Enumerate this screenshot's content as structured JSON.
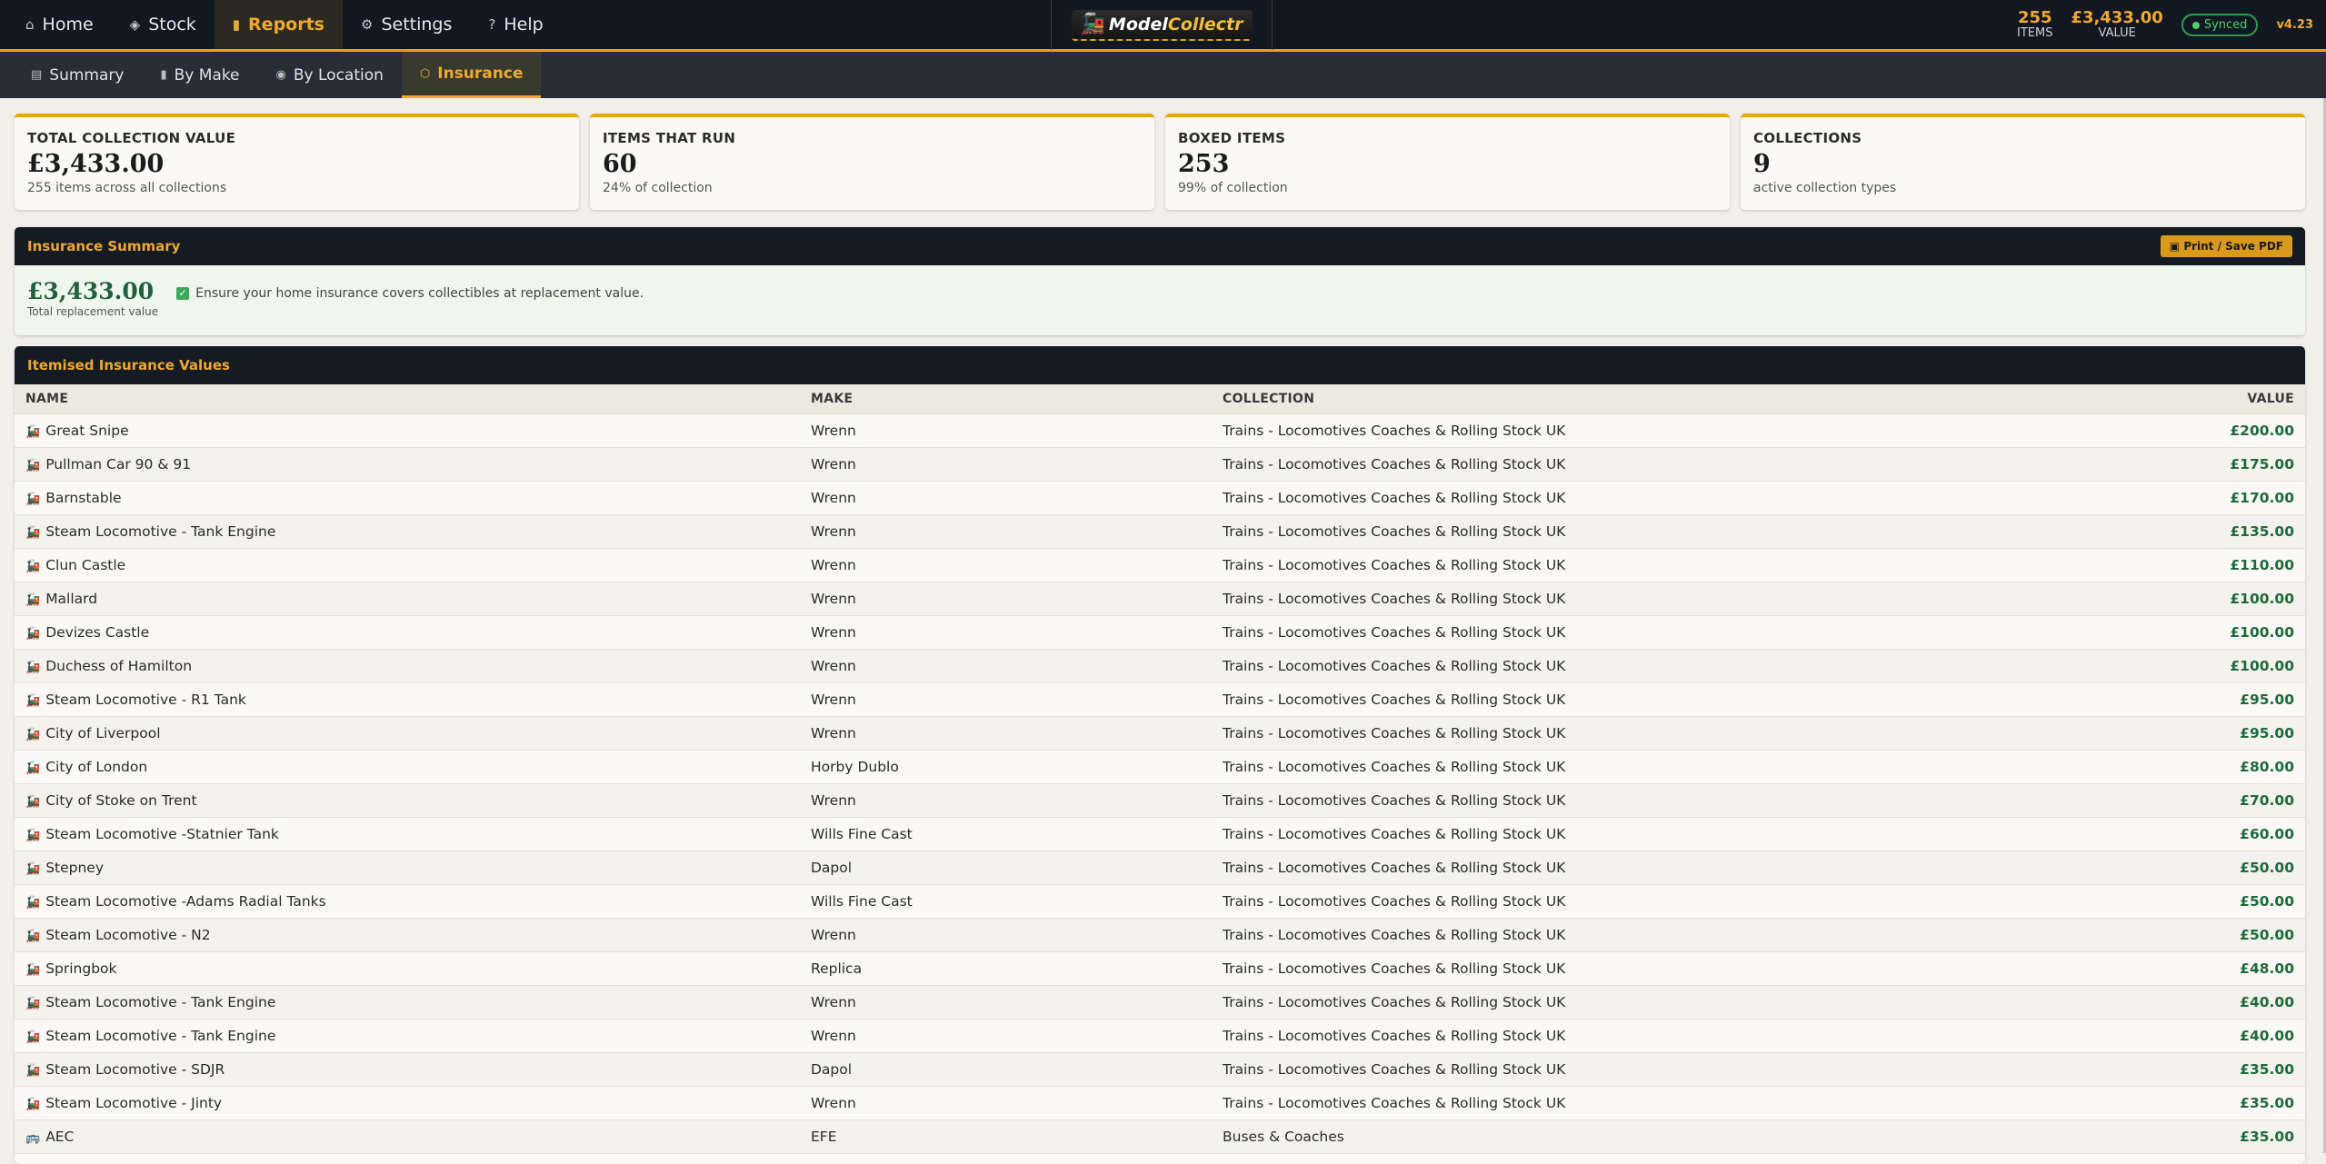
{
  "nav": {
    "items": [
      {
        "label": "Home",
        "icon": "home-icon"
      },
      {
        "label": "Stock",
        "icon": "box-icon"
      },
      {
        "label": "Reports",
        "icon": "bar-chart-icon",
        "active": true
      },
      {
        "label": "Settings",
        "icon": "gear-icon"
      },
      {
        "label": "Help",
        "icon": "question-icon"
      }
    ]
  },
  "logo": {
    "part1": "Model",
    "part2": "Collectr"
  },
  "header_stats": {
    "items_value": "255",
    "items_label": "ITEMS",
    "value_value": "£3,433.00",
    "value_label": "VALUE",
    "sync_label": "Synced",
    "version": "v4.23"
  },
  "subnav": {
    "items": [
      {
        "label": "Summary"
      },
      {
        "label": "By Make"
      },
      {
        "label": "By Location"
      },
      {
        "label": "Insurance",
        "active": true
      }
    ]
  },
  "cards": [
    {
      "label": "TOTAL COLLECTION VALUE",
      "value": "£3,433.00",
      "sub": "255 items across all collections"
    },
    {
      "label": "ITEMS THAT RUN",
      "value": "60",
      "sub": "24% of collection"
    },
    {
      "label": "BOXED ITEMS",
      "value": "253",
      "sub": "99% of collection"
    },
    {
      "label": "COLLECTIONS",
      "value": "9",
      "sub": "active collection types"
    }
  ],
  "insurance": {
    "title": "Insurance Summary",
    "print_label": "Print / Save PDF",
    "amount": "£3,433.00",
    "amount_label": "Total replacement value",
    "note": "Ensure your home insurance covers collectibles at replacement value."
  },
  "itemised": {
    "title": "Itemised Insurance Values",
    "headers": {
      "name": "NAME",
      "make": "MAKE",
      "collection": "COLLECTION",
      "value": "VALUE"
    },
    "rows": [
      {
        "name": "Great Snipe",
        "make": "Wrenn",
        "collection": "Trains - Locomotives Coaches & Rolling Stock UK",
        "value": "£200.00"
      },
      {
        "name": "Pullman Car 90 & 91",
        "make": "Wrenn",
        "collection": "Trains - Locomotives Coaches & Rolling Stock UK",
        "value": "£175.00"
      },
      {
        "name": "Barnstable",
        "make": "Wrenn",
        "collection": "Trains - Locomotives Coaches & Rolling Stock UK",
        "value": "£170.00"
      },
      {
        "name": "Steam Locomotive - Tank Engine",
        "make": "Wrenn",
        "collection": "Trains - Locomotives Coaches & Rolling Stock UK",
        "value": "£135.00"
      },
      {
        "name": "Clun Castle",
        "make": "Wrenn",
        "collection": "Trains - Locomotives Coaches & Rolling Stock UK",
        "value": "£110.00"
      },
      {
        "name": "Mallard",
        "make": "Wrenn",
        "collection": "Trains - Locomotives Coaches & Rolling Stock UK",
        "value": "£100.00"
      },
      {
        "name": "Devizes Castle",
        "make": "Wrenn",
        "collection": "Trains - Locomotives Coaches & Rolling Stock UK",
        "value": "£100.00"
      },
      {
        "name": "Duchess of Hamilton",
        "make": "Wrenn",
        "collection": "Trains - Locomotives Coaches & Rolling Stock UK",
        "value": "£100.00"
      },
      {
        "name": "Steam Locomotive - R1 Tank",
        "make": "Wrenn",
        "collection": "Trains - Locomotives Coaches & Rolling Stock UK",
        "value": "£95.00"
      },
      {
        "name": "City of Liverpool",
        "make": "Wrenn",
        "collection": "Trains - Locomotives Coaches & Rolling Stock UK",
        "value": "£95.00"
      },
      {
        "name": "City of London",
        "make": "Horby Dublo",
        "collection": "Trains - Locomotives Coaches & Rolling Stock UK",
        "value": "£80.00"
      },
      {
        "name": "City of Stoke on Trent",
        "make": "Wrenn",
        "collection": "Trains - Locomotives Coaches & Rolling Stock UK",
        "value": "£70.00"
      },
      {
        "name": "Steam Locomotive -Statnier Tank",
        "make": "Wills Fine Cast",
        "collection": "Trains - Locomotives Coaches & Rolling Stock UK",
        "value": "£60.00"
      },
      {
        "name": "Stepney",
        "make": "Dapol",
        "collection": "Trains - Locomotives Coaches & Rolling Stock UK",
        "value": "£50.00"
      },
      {
        "name": "Steam Locomotive -Adams Radial Tanks",
        "make": "Wills Fine Cast",
        "collection": "Trains - Locomotives Coaches & Rolling Stock UK",
        "value": "£50.00"
      },
      {
        "name": "Steam Locomotive - N2",
        "make": "Wrenn",
        "collection": "Trains - Locomotives Coaches & Rolling Stock UK",
        "value": "£50.00"
      },
      {
        "name": "Springbok",
        "make": "Replica",
        "collection": "Trains - Locomotives Coaches & Rolling Stock UK",
        "value": "£48.00"
      },
      {
        "name": "Steam Locomotive - Tank Engine",
        "make": "Wrenn",
        "collection": "Trains - Locomotives Coaches & Rolling Stock UK",
        "value": "£40.00"
      },
      {
        "name": "Steam Locomotive - Tank Engine",
        "make": "Wrenn",
        "collection": "Trains - Locomotives Coaches & Rolling Stock UK",
        "value": "£40.00"
      },
      {
        "name": "Steam Locomotive - SDJR",
        "make": "Dapol",
        "collection": "Trains - Locomotives Coaches & Rolling Stock UK",
        "value": "£35.00"
      },
      {
        "name": "Steam Locomotive - Jinty",
        "make": "Wrenn",
        "collection": "Trains - Locomotives Coaches & Rolling Stock UK",
        "value": "£35.00"
      },
      {
        "name": "AEC",
        "make": "EFE",
        "collection": "Buses & Coaches",
        "value": "£35.00",
        "icon": "bus-icon"
      }
    ]
  },
  "colors": {
    "accent": "#e8a317",
    "nav_bg": "#121821",
    "value_green": "#1f6a3c"
  }
}
